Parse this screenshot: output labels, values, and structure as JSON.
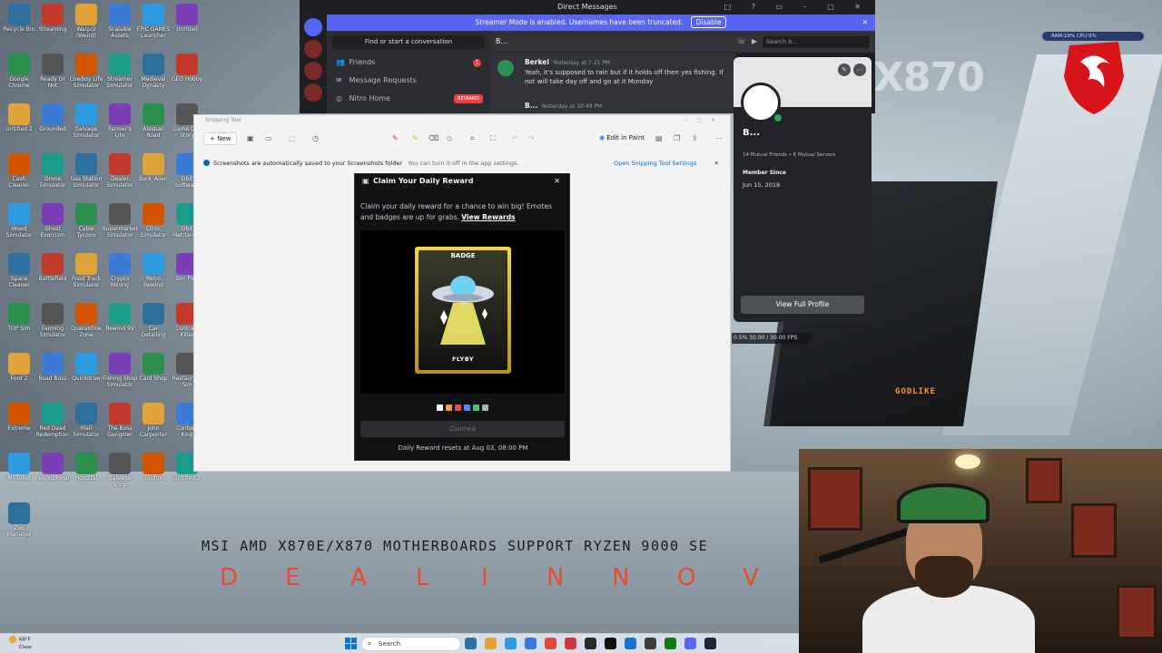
{
  "discord": {
    "title": "Direct Messages",
    "window_controls": "□ ? ▭ – ▢ ✕",
    "streamer_banner": "Streamer Mode is enabled. Usernames have been truncated.",
    "disable_label": "Disable",
    "close_glyph": "✕",
    "find_conversation": "Find or start a conversation",
    "nav": [
      {
        "label": "Friends",
        "icon": "friends-icon",
        "glyph": "👥",
        "badge": "1"
      },
      {
        "label": "Message Requests",
        "icon": "mail-icon",
        "glyph": "✉"
      },
      {
        "label": "Nitro Home",
        "icon": "nitro-icon",
        "glyph": "◎",
        "tag": "REWARD"
      }
    ],
    "chat_header": "B...",
    "search_placeholder": "Search b...",
    "messages": [
      {
        "author": "Berkel",
        "time": "Yesterday at 7:21 PM",
        "text": "Yeah, it's supposed to rain but if it holds off then yes fishing. If not will take day off and go at it Monday"
      },
      {
        "author": "B...",
        "time": "Yesterday at 10:49 PM"
      }
    ],
    "profile": {
      "name": "B...",
      "mutuals": "14 Mutual Friends • 6 Mutual Servers",
      "member_since_label": "Member Since",
      "member_since": "Jun 15, 2018",
      "view_full_profile": "View Full Profile"
    },
    "fps_overlay": "0.5%  30.00 / 30.00 FPS"
  },
  "snipping_tool": {
    "title": "Snipping Tool",
    "new_label": "New",
    "edit_in_paint": "Edit in Paint",
    "info_text": "Screenshots are automatically saved to your Screenshots folder",
    "info_sub": "You can turn it off in the app settings.",
    "info_link": "Open Snipping Tool Settings",
    "close_glyph": "✕"
  },
  "reward": {
    "title": "Claim Your Daily Reward",
    "close_glyph": "✕",
    "description": "Claim your daily reward for a chance to win big! Emotes and badges are up for grabs.",
    "link": "View Rewards",
    "badge_label": "BADGE",
    "item_name": "FLYBY",
    "swatch_colors": [
      "#ffffff",
      "#f4a02a",
      "#e84a4a",
      "#4f8cf5",
      "#46c46a",
      "#b0b0b0"
    ],
    "claimed_label": "Claimed",
    "resets_text": "Daily Reward resets at Aug 03, 08:00 PM"
  },
  "overlay": {
    "ticker": "MSI AMD X870E/X870 MOTHERBOARDS SUPPORT RYZEN 9000 SE",
    "spread_letters": [
      "D",
      "E",
      "A",
      "L",
      "I",
      "N",
      "N",
      "O",
      "V"
    ],
    "msi_ram": "RAM:19%  CPU:9%",
    "godlike": "GODLIKE",
    "brand": "X870"
  },
  "taskbar": {
    "weather_temp": "68°F",
    "weather_desc": "Clear",
    "search_placeholder": "Search",
    "app_colors": [
      "#2f6f9f",
      "#e0a33a",
      "#2e9be0",
      "#3b7bd6",
      "#e04a3a",
      "#d2353b",
      "#2b2b2b",
      "#111111",
      "#1c6fd1",
      "#3d3d3d",
      "#107c10",
      "#5865f2",
      "#1b2838"
    ]
  },
  "desktop_icons": [
    "Recycle Bin",
    "Streaming",
    "Warp/2 (Weird)",
    "Scalable Assets (UE5)",
    "EPIC GAMES Launcher",
    "Untitled",
    "Google Chrome",
    "Ready Or Not",
    "Cowboy Life Simulator",
    "Streamer Simulator",
    "Medieval Dynasty",
    "GEO Hobby",
    "Untitled 2",
    "Grounded",
    "Salvage Simulator",
    "Farmer's Life",
    "Alaskan Road Trucker",
    "Game Dev Story",
    "Cash Cleaner",
    "Drone Simulator",
    "Gas Station Simulator",
    "Dealer Simulator",
    "Berk_Alien",
    "Obit Software",
    "Wood Simulator",
    "Ghost Exorcism",
    "Cable Tycoon",
    "Supermarket Simulator",
    "Clinic Simulator",
    "Obit Matriarchy",
    "Space Cleaner",
    "Battlefield",
    "Food Truck Simulator",
    "Crypto Mining",
    "Retro Rewind",
    "Sim Plus",
    "TOP Sim",
    "Farming Simulator 25",
    "Quarantine Zone",
    "Rewind 99",
    "Car Detailing",
    "Contract Killer",
    "Ford 2",
    "Road Boss",
    "Quickdraw",
    "Fishing Shop Simulator",
    "Card Shop",
    "Restaurant Sim",
    "Extreme",
    "Red Dead Redemption 2",
    "Mall Simulator",
    "The Boss Gangster",
    "John Carpenter",
    "Content King",
    "Mr Toilet",
    "Revolutionary",
    "Hospital",
    "Salvage Shop",
    "Firefox",
    "Untitled 3",
    "Zoo Manager"
  ],
  "colors": {
    "discord_blurple": "#5865f2",
    "reward_gold": "#f4d34a",
    "overlay_orange": "#e84a2d"
  }
}
